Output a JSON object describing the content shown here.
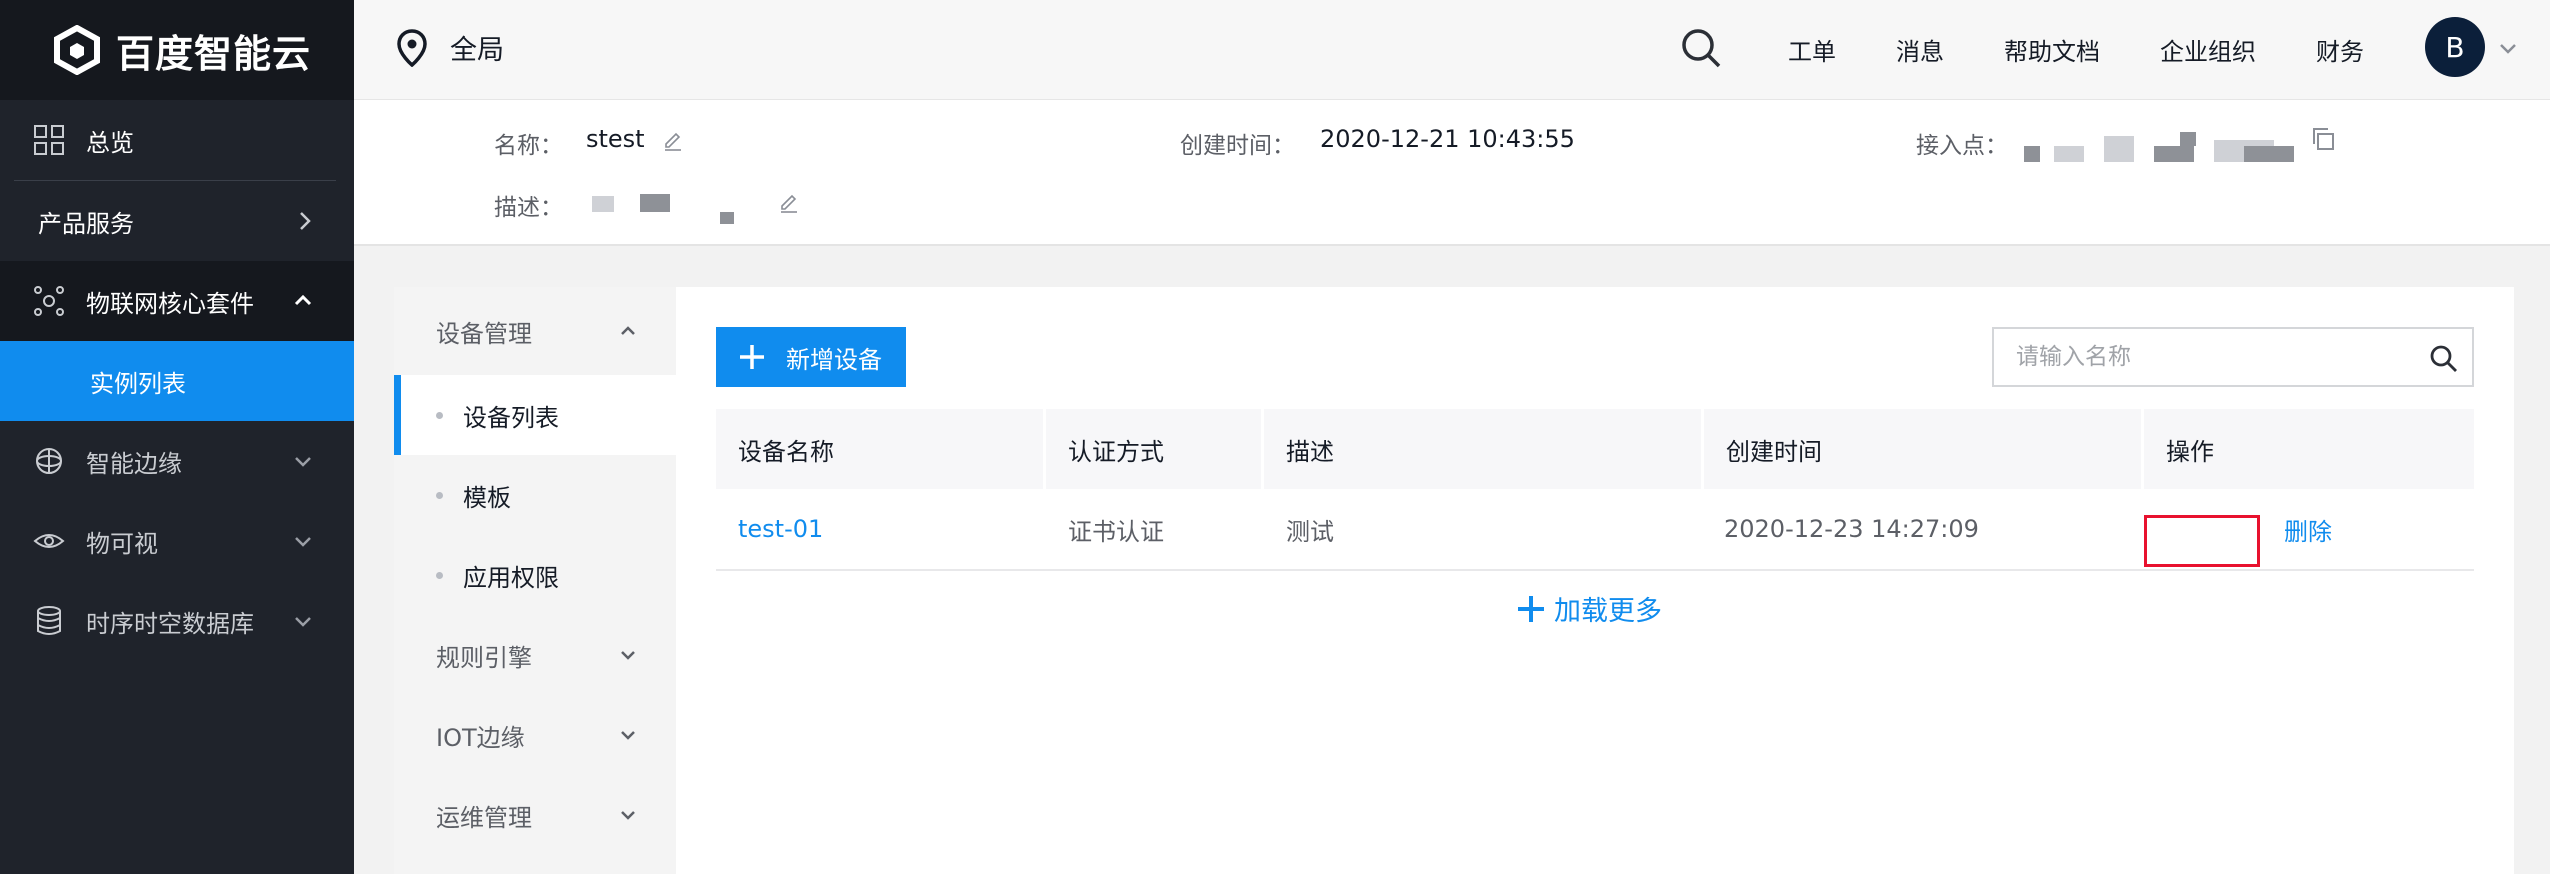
{
  "brand": {
    "name": "百度智能云"
  },
  "sidebar": {
    "items": [
      {
        "label": "总览",
        "icon": "grid-icon"
      },
      {
        "label": "产品服务",
        "icon": "chevron-right-icon"
      },
      {
        "label": "物联网核心套件",
        "icon": "iot-hub-icon"
      },
      {
        "label": "实例列表"
      },
      {
        "label": "智能边缘",
        "icon": "edge-icon"
      },
      {
        "label": "物可视",
        "icon": "eye-icon"
      },
      {
        "label": "时序时空数据库",
        "icon": "database-icon"
      }
    ]
  },
  "header": {
    "region": "全局",
    "links": [
      "工单",
      "消息",
      "帮助文档",
      "企业组织",
      "财务"
    ],
    "avatar": "B"
  },
  "info": {
    "name_label": "名称：",
    "name_value": "stest",
    "created_label": "创建时间：",
    "created_value": "2020-12-21 10:43:55",
    "endpoint_label": "接入点：",
    "desc_label": "描述："
  },
  "subnav": {
    "group_title": "设备管理",
    "items": [
      "设备列表",
      "模板",
      "应用权限"
    ],
    "groups": [
      "规则引擎",
      "IOT边缘",
      "运维管理"
    ]
  },
  "toolbar": {
    "add_label": "新增设备",
    "search_placeholder": "请输入名称"
  },
  "table": {
    "headers": [
      "设备名称",
      "认证方式",
      "描述",
      "创建时间",
      "操作"
    ],
    "rows": [
      {
        "name": "test-01",
        "auth": "证书认证",
        "desc": "测试",
        "created": "2020-12-23 14:27:09",
        "action": "删除"
      }
    ]
  },
  "load_more": "加载更多",
  "colors": {
    "accent": "#108cee",
    "sidebar_bg": "#1f232b",
    "highlight": "#e8112e"
  }
}
